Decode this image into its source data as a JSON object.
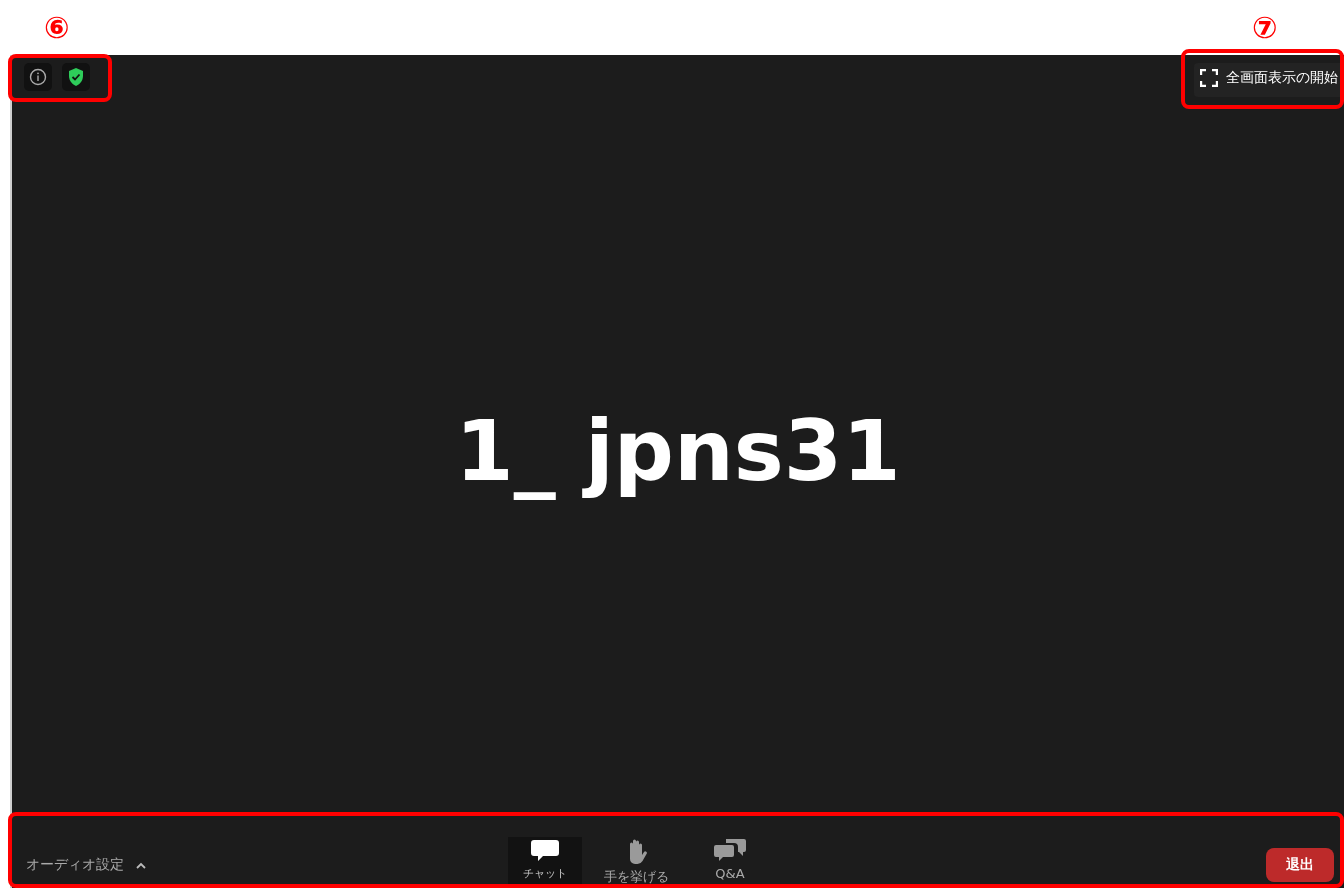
{
  "annotations": [
    {
      "kind": "security",
      "number": "⑥"
    },
    {
      "kind": "fullscreen",
      "number": "⑦"
    },
    {
      "kind": "toolbar"
    }
  ],
  "top_bar": {
    "fullscreen_button": "全画面表示の開始"
  },
  "participant_name": "1_ jpns31",
  "toolbar": {
    "audio_settings": "オーディオ設定",
    "items": [
      {
        "kind": "chat",
        "label": "チャット",
        "selected": true
      },
      {
        "kind": "hand",
        "label": "手を挙げる",
        "selected": false
      },
      {
        "kind": "qa",
        "label": "Q&A",
        "selected": false
      }
    ],
    "leave_button": "退出"
  }
}
